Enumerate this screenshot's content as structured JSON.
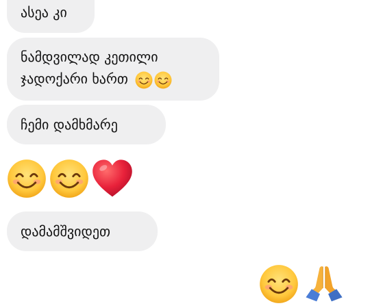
{
  "chat": {
    "messages": [
      {
        "text": "ასეა კი"
      },
      {
        "lines": [
          "ნამდვილად კეთილი",
          "ჯადოქარი ხართ"
        ],
        "emojis": [
          "smiling-face-icon",
          "smiling-face-icon"
        ]
      },
      {
        "text": "ჩემი დამხმარე"
      },
      {
        "emojis": [
          "smiling-face-icon",
          "smiling-face-icon",
          "red-heart-icon"
        ]
      },
      {
        "text": "დამამშვიდეთ"
      }
    ],
    "outgoing": {
      "emojis": [
        "smiling-face-icon",
        "folded-hands-icon"
      ]
    }
  },
  "colors": {
    "bubble_bg": "#efeff0",
    "emoji_face": "#ffc83d",
    "heart": "#e8213a",
    "hands": "#f6b23c",
    "sleeve": "#4a7dd6"
  }
}
